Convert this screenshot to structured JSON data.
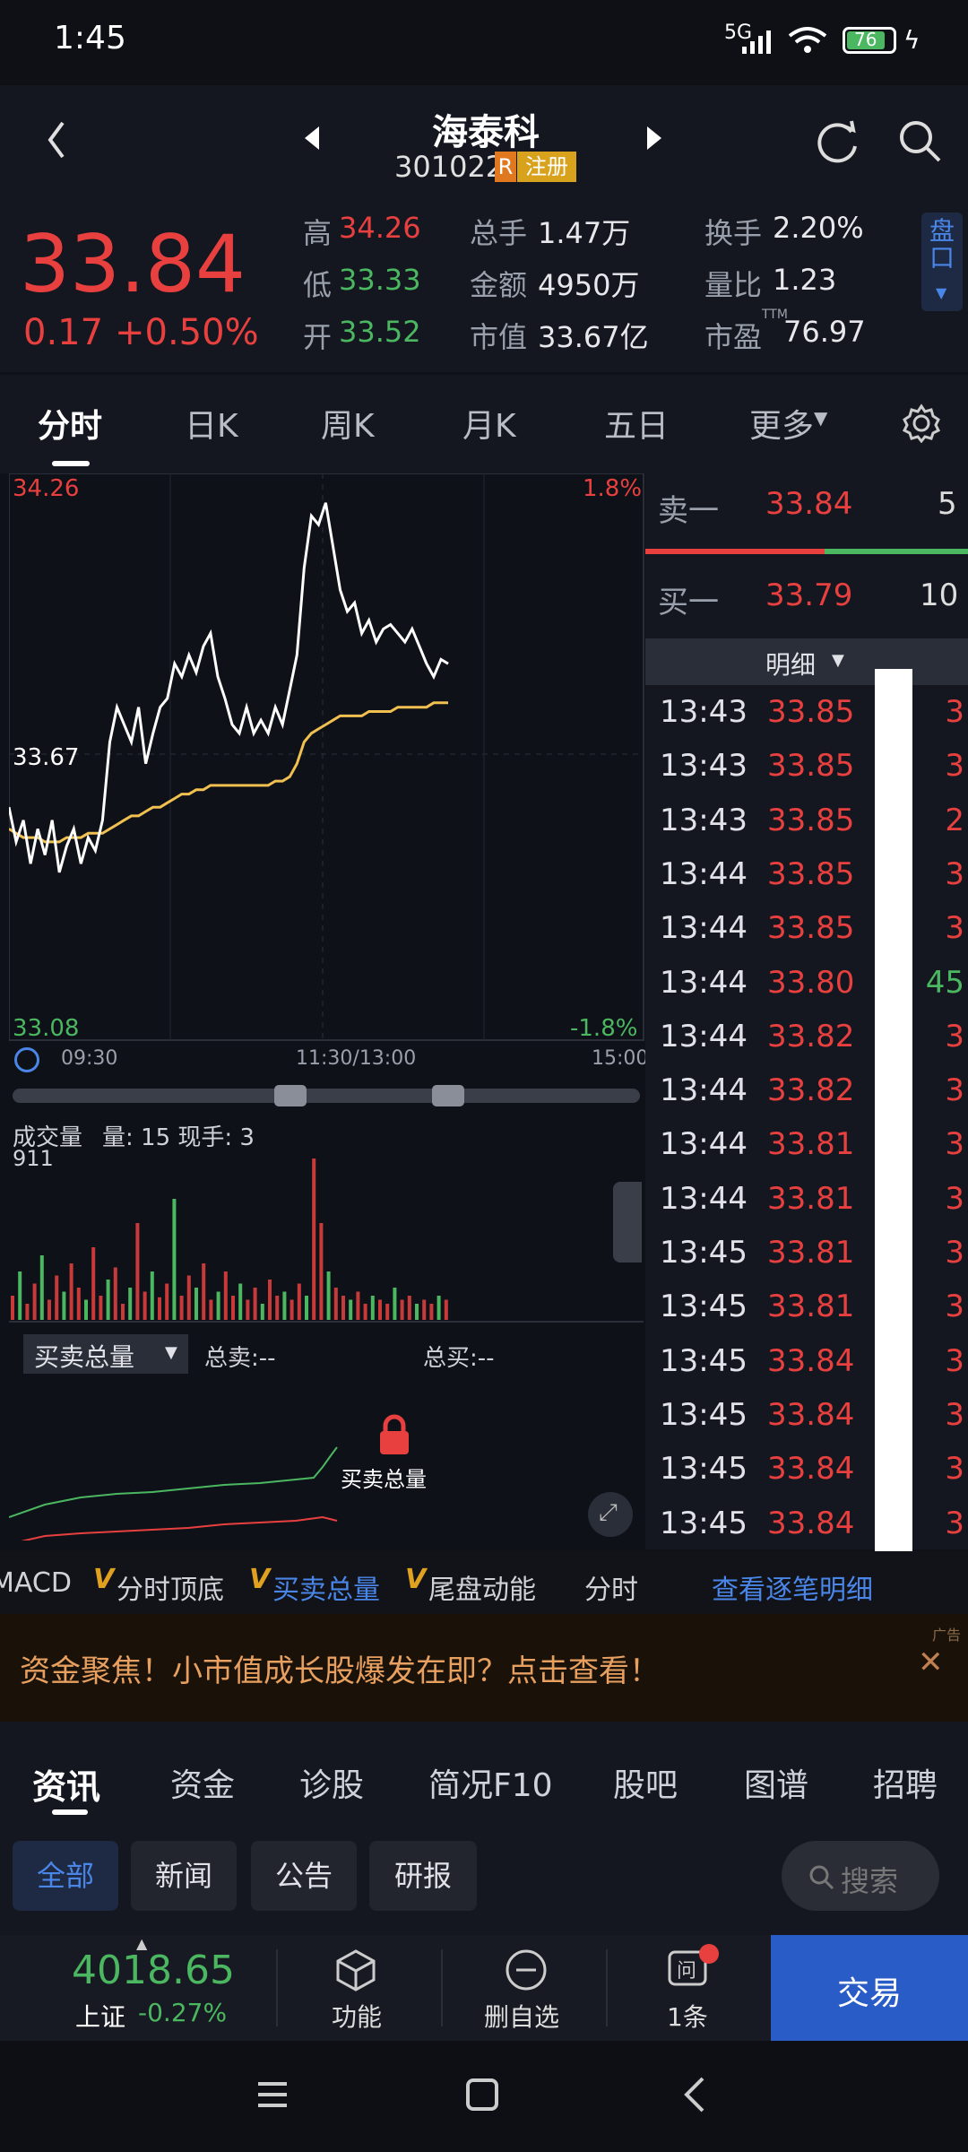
{
  "status": {
    "time": "1:45",
    "network": "5G",
    "battery": "76"
  },
  "stock": {
    "name": "海泰科",
    "code": "301022",
    "tag_r": "R",
    "tag_reg": "注册",
    "price": "33.84",
    "change": "0.17",
    "change_pct": "+0.50%"
  },
  "quote": {
    "high_label": "高",
    "high": "34.26",
    "low_label": "低",
    "low": "33.33",
    "open_label": "开",
    "open": "33.52",
    "vol_label": "总手",
    "vol": "1.47万",
    "amt_label": "金额",
    "amt": "4950万",
    "cap_label": "市值",
    "cap": "33.67亿",
    "turn_label": "换手",
    "turn": "2.20%",
    "vr_label": "量比",
    "vr": "1.23",
    "pe_label": "市盈",
    "pe_sup": "TTM",
    "pe": "76.97",
    "side_btn": "盘口"
  },
  "tabs": [
    "分时",
    "日K",
    "周K",
    "月K",
    "五日",
    "更多"
  ],
  "chart": {
    "top_price": "34.26",
    "top_pct": "1.8%",
    "mid_price": "33.67",
    "bot_price": "33.08",
    "bot_pct": "-1.8%",
    "t_start": "09:30",
    "t_mid": "11:30/13:00",
    "t_end": "15:00",
    "vol_title": "成交量",
    "vol_info": "量: 15  现手: 3",
    "vol_max": "911",
    "bs_select": "买卖总量",
    "bs_sell": "总卖:--",
    "bs_buy": "总买:--",
    "lock_label": "买卖总量"
  },
  "chart_data": {
    "type": "line",
    "series": [
      {
        "values": [
          33.55,
          33.47,
          33.52,
          33.42,
          33.5,
          33.44,
          33.52,
          33.4,
          33.46,
          33.5,
          33.42,
          33.48,
          33.45,
          33.52,
          33.7,
          33.78,
          33.74,
          33.7,
          33.78,
          33.65,
          33.72,
          33.78,
          33.8,
          33.88,
          33.85,
          33.9,
          33.86,
          33.92,
          33.95,
          33.85,
          33.8,
          33.74,
          33.72,
          33.78,
          33.72,
          33.75,
          33.72,
          33.78,
          33.74,
          33.82,
          33.9,
          34.1,
          34.22,
          34.2,
          34.25,
          34.15,
          34.05,
          34.0,
          34.02,
          33.95,
          33.98,
          33.93,
          33.96,
          33.97,
          33.95,
          33.93,
          33.96,
          33.92,
          33.88,
          33.85,
          33.89,
          33.88
        ]
      },
      {
        "values": [
          33.5,
          33.49,
          33.48,
          33.48,
          33.48,
          33.47,
          33.47,
          33.47,
          33.48,
          33.48,
          33.48,
          33.49,
          33.49,
          33.49,
          33.5,
          33.51,
          33.52,
          33.53,
          33.53,
          33.54,
          33.55,
          33.55,
          33.56,
          33.57,
          33.58,
          33.58,
          33.59,
          33.59,
          33.6,
          33.6,
          33.6,
          33.6,
          33.6,
          33.6,
          33.6,
          33.6,
          33.6,
          33.61,
          33.61,
          33.62,
          33.65,
          33.7,
          33.72,
          33.73,
          33.74,
          33.75,
          33.76,
          33.76,
          33.76,
          33.76,
          33.77,
          33.77,
          33.77,
          33.77,
          33.78,
          33.78,
          33.78,
          33.78,
          33.78,
          33.79,
          33.79,
          33.79
        ]
      }
    ],
    "ylim": [
      33.08,
      34.26
    ]
  },
  "orderbook": {
    "sell_label": "卖一",
    "sell_price": "33.84",
    "sell_vol": "5",
    "buy_label": "买一",
    "buy_price": "33.79",
    "buy_vol": "10",
    "detail": "明细",
    "ticks": [
      [
        "13:43",
        "33.85",
        "3"
      ],
      [
        "13:43",
        "33.85",
        "3"
      ],
      [
        "13:43",
        "33.85",
        "2"
      ],
      [
        "13:44",
        "33.85",
        "3"
      ],
      [
        "13:44",
        "33.85",
        "3"
      ],
      [
        "13:44",
        "33.80",
        "45"
      ],
      [
        "13:44",
        "33.82",
        "3"
      ],
      [
        "13:44",
        "33.82",
        "3"
      ],
      [
        "13:44",
        "33.81",
        "3"
      ],
      [
        "13:44",
        "33.81",
        "3"
      ],
      [
        "13:45",
        "33.81",
        "3"
      ],
      [
        "13:45",
        "33.81",
        "3"
      ],
      [
        "13:45",
        "33.84",
        "3"
      ],
      [
        "13:45",
        "33.84",
        "3"
      ],
      [
        "13:45",
        "33.84",
        "3"
      ],
      [
        "13:45",
        "33.84",
        "3"
      ]
    ]
  },
  "features": {
    "macd": "MACD",
    "f1": "分时顶底",
    "f2": "买卖总量",
    "f3": "尾盘动能",
    "f4": "分时",
    "link": "查看逐笔明细"
  },
  "ad": {
    "text": "资金聚焦！小市值成长股爆发在即？点击查看！",
    "tag": "广告"
  },
  "news_tabs": [
    "资讯",
    "资金",
    "诊股",
    "简况F10",
    "股吧",
    "图谱",
    "招聘"
  ],
  "chips": [
    "全部",
    "新闻",
    "公告",
    "研报"
  ],
  "search": "搜索",
  "bottom": {
    "index_val": "4018.65",
    "index_name": "上证",
    "index_pct": "-0.27%",
    "func": "功能",
    "del": "删自选",
    "msg": "1条",
    "trade": "交易"
  }
}
